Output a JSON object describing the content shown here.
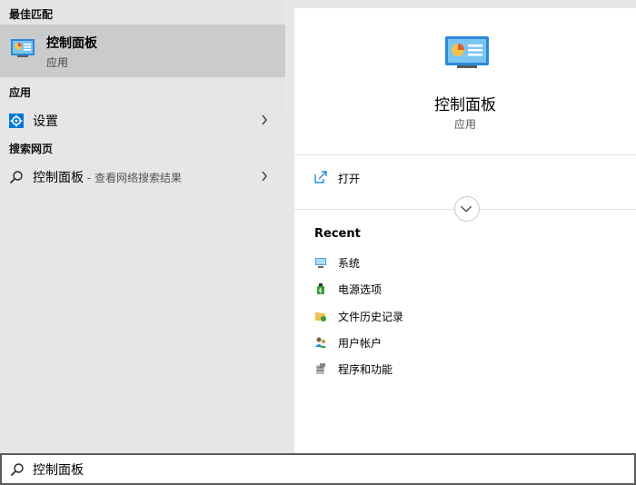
{
  "left": {
    "best_match_label": "最佳匹配",
    "best_match": {
      "title": "控制面板",
      "subtitle": "应用",
      "icon": "control-panel-icon"
    },
    "apps_label": "应用",
    "apps": [
      {
        "label": "设置",
        "icon": "settings-gear-icon"
      }
    ],
    "web_label": "搜索网页",
    "web": [
      {
        "label": "控制面板",
        "hint": " - 查看网络搜索结果",
        "icon": "search-icon"
      }
    ]
  },
  "right": {
    "title": "控制面板",
    "subtitle": "应用",
    "open_label": "打开",
    "recent_label": "Recent",
    "recent": [
      {
        "label": "系统",
        "icon": "system-icon"
      },
      {
        "label": "电源选项",
        "icon": "power-options-icon"
      },
      {
        "label": "文件历史记录",
        "icon": "file-history-icon"
      },
      {
        "label": "用户帐户",
        "icon": "user-accounts-icon"
      },
      {
        "label": "程序和功能",
        "icon": "programs-features-icon"
      }
    ]
  },
  "search": {
    "value": "控制面板"
  },
  "colors": {
    "accent": "#0078d7",
    "selected_bg": "#c9cbcd",
    "pane_bg": "#e6e7e8"
  }
}
